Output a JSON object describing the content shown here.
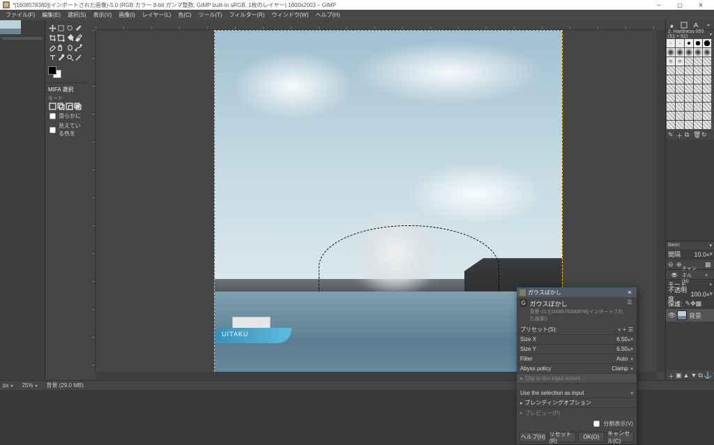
{
  "titlebar": {
    "text": "*[1608578380](インポートされた画像)-5.0 (RGB カラー 8-bit ガンマ整数, GIMP built-in sRGB, 1枚のレイヤー) 1600x2003 – GIMP"
  },
  "menubar": [
    "ファイル(F)",
    "編集(E)",
    "選択(S)",
    "表示(V)",
    "画像(I)",
    "レイヤー(L)",
    "色(C)",
    "ツール(T)",
    "フィルター(R)",
    "ウィンドウ(W)",
    "ヘルプ(H)"
  ],
  "tool_options": {
    "title": "MIFA 選択",
    "mode_label": "モード:",
    "cb1_label": "滑らかに",
    "cb2_label": "見えている色を"
  },
  "dialog": {
    "window_title": "ガウスぼかし",
    "heading": "ガウスぼかし",
    "subheading": "背景-21 ([1608578380879](インポートされた画像))",
    "preset_label": "プリセット(S):",
    "size_x_label": "Size X",
    "size_x_value": "6.50",
    "size_y_label": "Size Y",
    "size_y_value": "6.50",
    "filter_label": "Filter",
    "filter_value": "Auto",
    "abyss_label": "Abyss policy",
    "abyss_value": "Clamp",
    "clip_label": "Clip to the input extent",
    "use_sel_label": "Use the selection as input",
    "blend_label": "ブレンディングオプション",
    "preview_label": "プレビュー(P)",
    "split_label": "分割表示(V)",
    "btn_help": "ヘルプ(H)",
    "btn_reset": "リセット(R)",
    "btn_ok": "OK(O)",
    "btn_cancel": "キャンセル(C)"
  },
  "right_dock": {
    "brush_name": "2. Hardness 050 (51 × 51)",
    "basic_label": "Basic",
    "spacing_label": "間隔",
    "spacing_value": "10.0",
    "mode_label": "モード",
    "opacity_label": "不透明度",
    "opacity_value": "100.0",
    "lock_label": "保護:",
    "layer_name": "背景",
    "channel_tab": "チャンネル(H)"
  },
  "status": {
    "unit": "px",
    "zoom": "25",
    "info": "背景 (29.0 MB)"
  },
  "boat_text": "UITAKU"
}
